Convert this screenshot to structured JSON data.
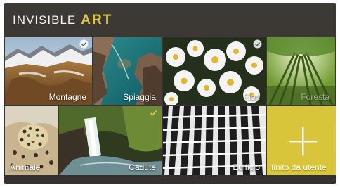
{
  "brand": {
    "part1": "INVISIBLE",
    "part2": "ART",
    "accent": "#dcc640"
  },
  "tiles": [
    {
      "label": "Montagne",
      "selected": true
    },
    {
      "label": "Spiaggia",
      "selected": false
    },
    {
      "label": "Fiori",
      "selected": true
    },
    {
      "label": "Foresta",
      "selected": false
    },
    {
      "label": "Animale",
      "selected": false
    },
    {
      "label": "Cadute",
      "selected": true
    },
    {
      "label": "Edificio",
      "selected": false
    }
  ],
  "custom": {
    "label": "finito da utente",
    "icon": "plus-icon",
    "color": "#d8c53a"
  }
}
